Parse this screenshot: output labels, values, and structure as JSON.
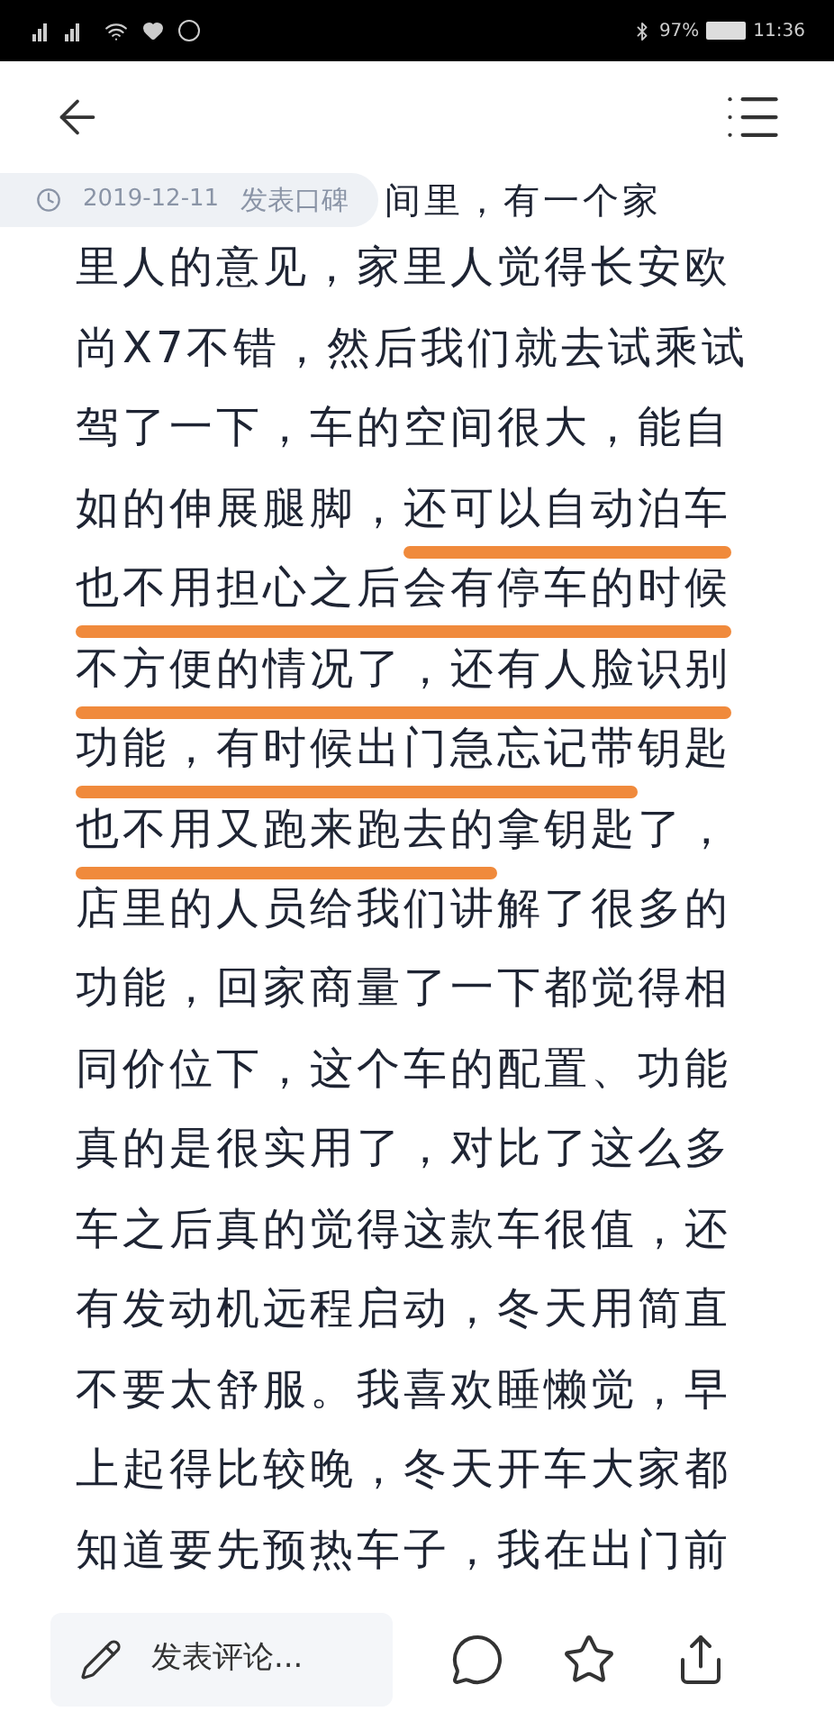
{
  "status_bar": {
    "battery": "97%",
    "time": "11:36"
  },
  "review_meta": {
    "date": "2019-12-11",
    "label": "发表口碑"
  },
  "lines": [
    {
      "segments": [
        {
          "text": "间里，有一个家",
          "underlined": false
        }
      ]
    },
    {
      "segments": [
        {
          "text": "里人的意见，家里人觉得长安欧",
          "underlined": false
        }
      ]
    },
    {
      "segments": [
        {
          "text": "尚X7不错，然后我们就去试乘试",
          "underlined": false
        }
      ]
    },
    {
      "segments": [
        {
          "text": "驾了一下，车的空间很大，能自",
          "underlined": false
        }
      ]
    },
    {
      "segments": [
        {
          "text": "如的伸展腿脚，",
          "underlined": false
        },
        {
          "text": "还可以自动泊车",
          "underlined": true
        }
      ]
    },
    {
      "segments": [
        {
          "text": "也不用担心之后会有停车的时候",
          "underlined": true
        }
      ]
    },
    {
      "segments": [
        {
          "text": "不方便的情况了，还有人脸识别",
          "underlined": true
        }
      ]
    },
    {
      "segments": [
        {
          "text": "功能，有时候出门急忘记带",
          "underlined": true
        },
        {
          "text": "钥匙",
          "underlined": false
        }
      ]
    },
    {
      "segments": [
        {
          "text": "也不用又跑来跑去的",
          "underlined": true
        },
        {
          "text": "拿钥匙了，",
          "underlined": false
        }
      ]
    },
    {
      "segments": [
        {
          "text": "店里的人员给我们讲解了很多的",
          "underlined": false
        }
      ]
    },
    {
      "segments": [
        {
          "text": "功能，回家商量了一下都觉得相",
          "underlined": false
        }
      ]
    },
    {
      "segments": [
        {
          "text": "同价位下，这个车的配置、功能",
          "underlined": false
        }
      ]
    },
    {
      "segments": [
        {
          "text": "真的是很实用了，对比了这么多",
          "underlined": false
        }
      ]
    },
    {
      "segments": [
        {
          "text": "车之后真的觉得这款车很值，还",
          "underlined": false
        }
      ]
    },
    {
      "segments": [
        {
          "text": "有发动机远程启动，冬天用简直",
          "underlined": false
        }
      ]
    },
    {
      "segments": [
        {
          "text": "不要太舒服。我喜欢睡懒觉，早",
          "underlined": false
        }
      ]
    },
    {
      "segments": [
        {
          "text": "上起得比较晚，冬天开车大家都",
          "underlined": false
        }
      ]
    },
    {
      "segments": [
        {
          "text": "知道要先预热车子，我在出门前",
          "underlined": false
        }
      ]
    }
  ],
  "bottom_bar": {
    "comment_placeholder": "发表评论..."
  }
}
